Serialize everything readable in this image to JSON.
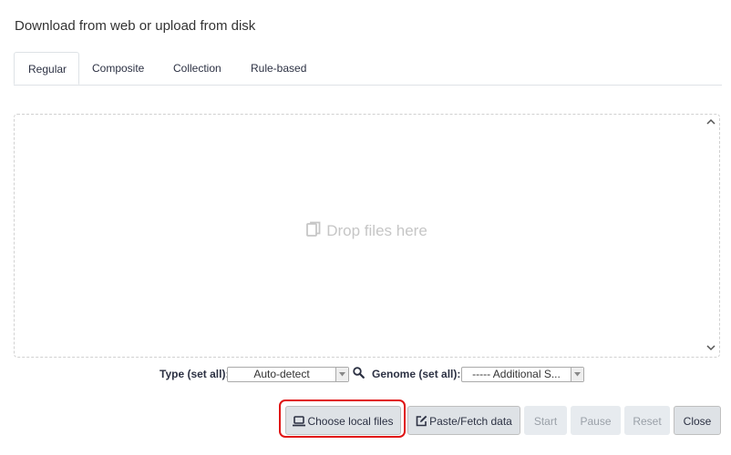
{
  "dialog": {
    "title": "Download from web or upload from disk"
  },
  "tabs": [
    {
      "label": "Regular",
      "active": true
    },
    {
      "label": "Composite",
      "active": false
    },
    {
      "label": "Collection",
      "active": false
    },
    {
      "label": "Rule-based",
      "active": false
    }
  ],
  "drop_zone": {
    "hint": "Drop files here",
    "icon": "copy-icon"
  },
  "settings": {
    "type_label": "Type (set all):",
    "type_value": "Auto-detect",
    "genome_label": "Genome (set all):",
    "genome_value": "----- Additional S..."
  },
  "buttons": {
    "choose_local": {
      "label": "Choose local files",
      "icon": "laptop-icon"
    },
    "paste_fetch": {
      "label": "Paste/Fetch data",
      "icon": "edit-icon"
    },
    "start": "Start",
    "pause": "Pause",
    "reset": "Reset",
    "close": "Close"
  },
  "colors": {
    "highlight": "#e01515",
    "button_bg": "#dee2e6",
    "drop_hint": "#c6c6c6"
  }
}
